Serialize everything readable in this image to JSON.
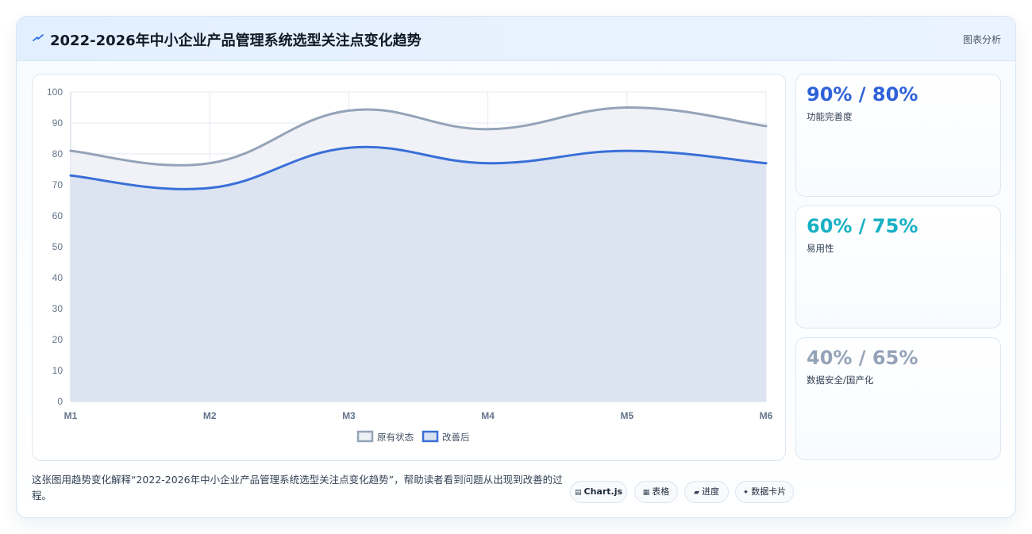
{
  "header": {
    "icon": "lightning-icon",
    "title": "2022-2026年中小企业产品管理系统选型关注点变化趋势",
    "right_link": "图表分析"
  },
  "chart_data": {
    "type": "area",
    "x": [
      "M1",
      "M2",
      "M3",
      "M4",
      "M5",
      "M6"
    ],
    "ylim": [
      0,
      100
    ],
    "yticks": [
      0,
      10,
      20,
      30,
      40,
      50,
      60,
      70,
      80,
      90,
      100
    ],
    "grid": true,
    "legend_position": "bottom",
    "series": [
      {
        "name": "原有状态",
        "values": [
          81,
          77,
          94,
          88,
          95,
          89
        ],
        "color": "#94a3b8",
        "fill": "#eef1f6"
      },
      {
        "name": "改善后",
        "values": [
          73,
          69,
          82,
          77,
          81,
          77
        ],
        "color": "#3a6fd8",
        "fill": "#d9e2f1"
      }
    ]
  },
  "kpis": [
    {
      "value": "90% / 80%",
      "label": "功能完善度",
      "color": "#2f62d8"
    },
    {
      "value": "60% / 75%",
      "label": "易用性",
      "color": "#17b0c4"
    },
    {
      "value": "40% / 65%",
      "label": "数据安全/国产化",
      "color": "#94a3b8"
    }
  ],
  "caption": "这张图用趋势变化解释“2022-2026年中小企业产品管理系统选型关注点变化趋势”，帮助读者看到问题从出现到改善的过程。",
  "tags": [
    {
      "icon": "chart-icon",
      "glyph": "▤",
      "label": "Chart.js"
    },
    {
      "icon": "table-icon",
      "glyph": "▦",
      "label": "表格"
    },
    {
      "icon": "progress-icon",
      "glyph": "▰",
      "label": "进度"
    },
    {
      "icon": "sparkle-icon",
      "glyph": "✦",
      "label": "数据卡片"
    }
  ]
}
